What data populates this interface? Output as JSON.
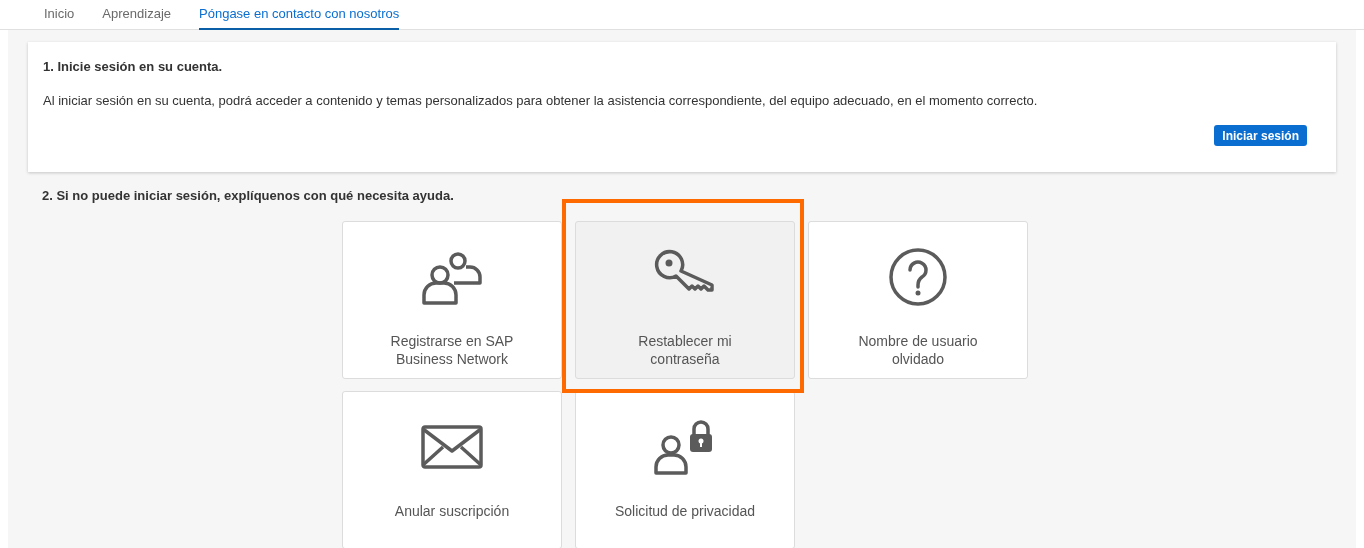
{
  "tabs": [
    {
      "label": "Inicio",
      "selected": false
    },
    {
      "label": "Aprendizaje",
      "selected": false
    },
    {
      "label": "Póngase en contacto con nosotros",
      "selected": true
    }
  ],
  "login_card": {
    "title": "1. Inicie sesión en su cuenta.",
    "text": "Al iniciar sesión en su cuenta, podrá acceder a contenido y temas personalizados para obtener la asistencia correspondiente, del equipo adecuado, en el momento correcto.",
    "button": "Iniciar sesión"
  },
  "help_section": {
    "title": "2. Si no puede iniciar sesión, explíquenos con qué necesita ayuda.",
    "tiles": [
      {
        "kind": "users",
        "label": "Registrarse en SAP Business Network",
        "selected": false
      },
      {
        "kind": "key",
        "label": "Restablecer mi contraseña",
        "selected": true
      },
      {
        "kind": "help",
        "label": "Nombre de usuario olvidado",
        "selected": false
      },
      {
        "kind": "mail",
        "label": "Anular suscripción",
        "selected": false
      },
      {
        "kind": "user-lock",
        "label": "Solicitud de privacidad",
        "selected": false
      }
    ]
  }
}
